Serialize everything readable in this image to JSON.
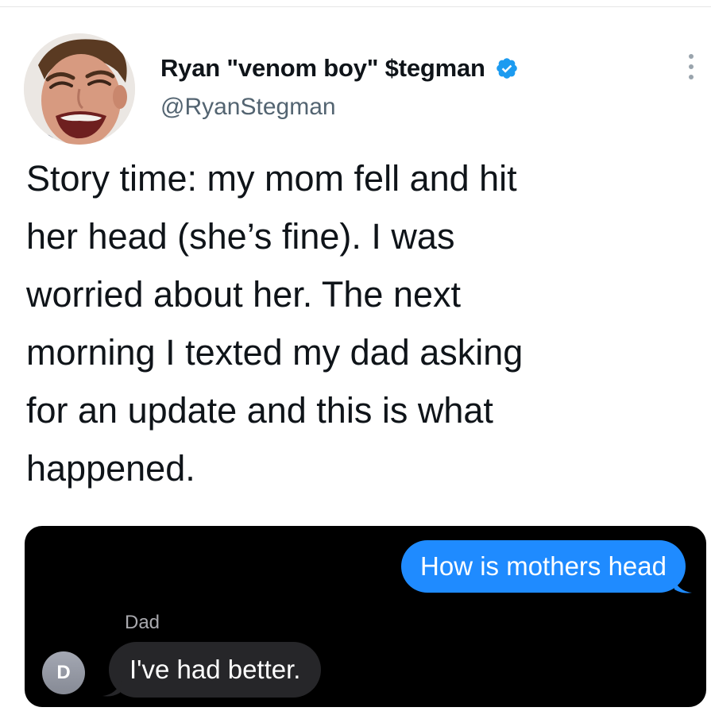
{
  "tweet": {
    "author": {
      "display_name": "Ryan \"venom boy\" $tegman",
      "handle": "@RyanStegman",
      "verified": true
    },
    "text_lines": [
      "Story time: my mom fell and hit",
      "her head (she’s fine). I was",
      "worried about her. The next",
      "morning I texted my dad asking",
      "for an update and this is what",
      "happened."
    ],
    "icons": {
      "verified": "verified-badge-icon",
      "more": "more-options-icon"
    },
    "colors": {
      "verified_blue": "#1d9bf0",
      "handle_gray": "#536471"
    }
  },
  "media": {
    "messages": [
      {
        "direction": "outgoing",
        "text": "How is mothers head"
      },
      {
        "direction": "incoming",
        "sender": "Dad",
        "text": "I've had better."
      }
    ],
    "contact_initial": "D",
    "colors": {
      "background": "#000000",
      "outgoing_bubble": "#1f8bff",
      "incoming_bubble": "#262629"
    }
  }
}
